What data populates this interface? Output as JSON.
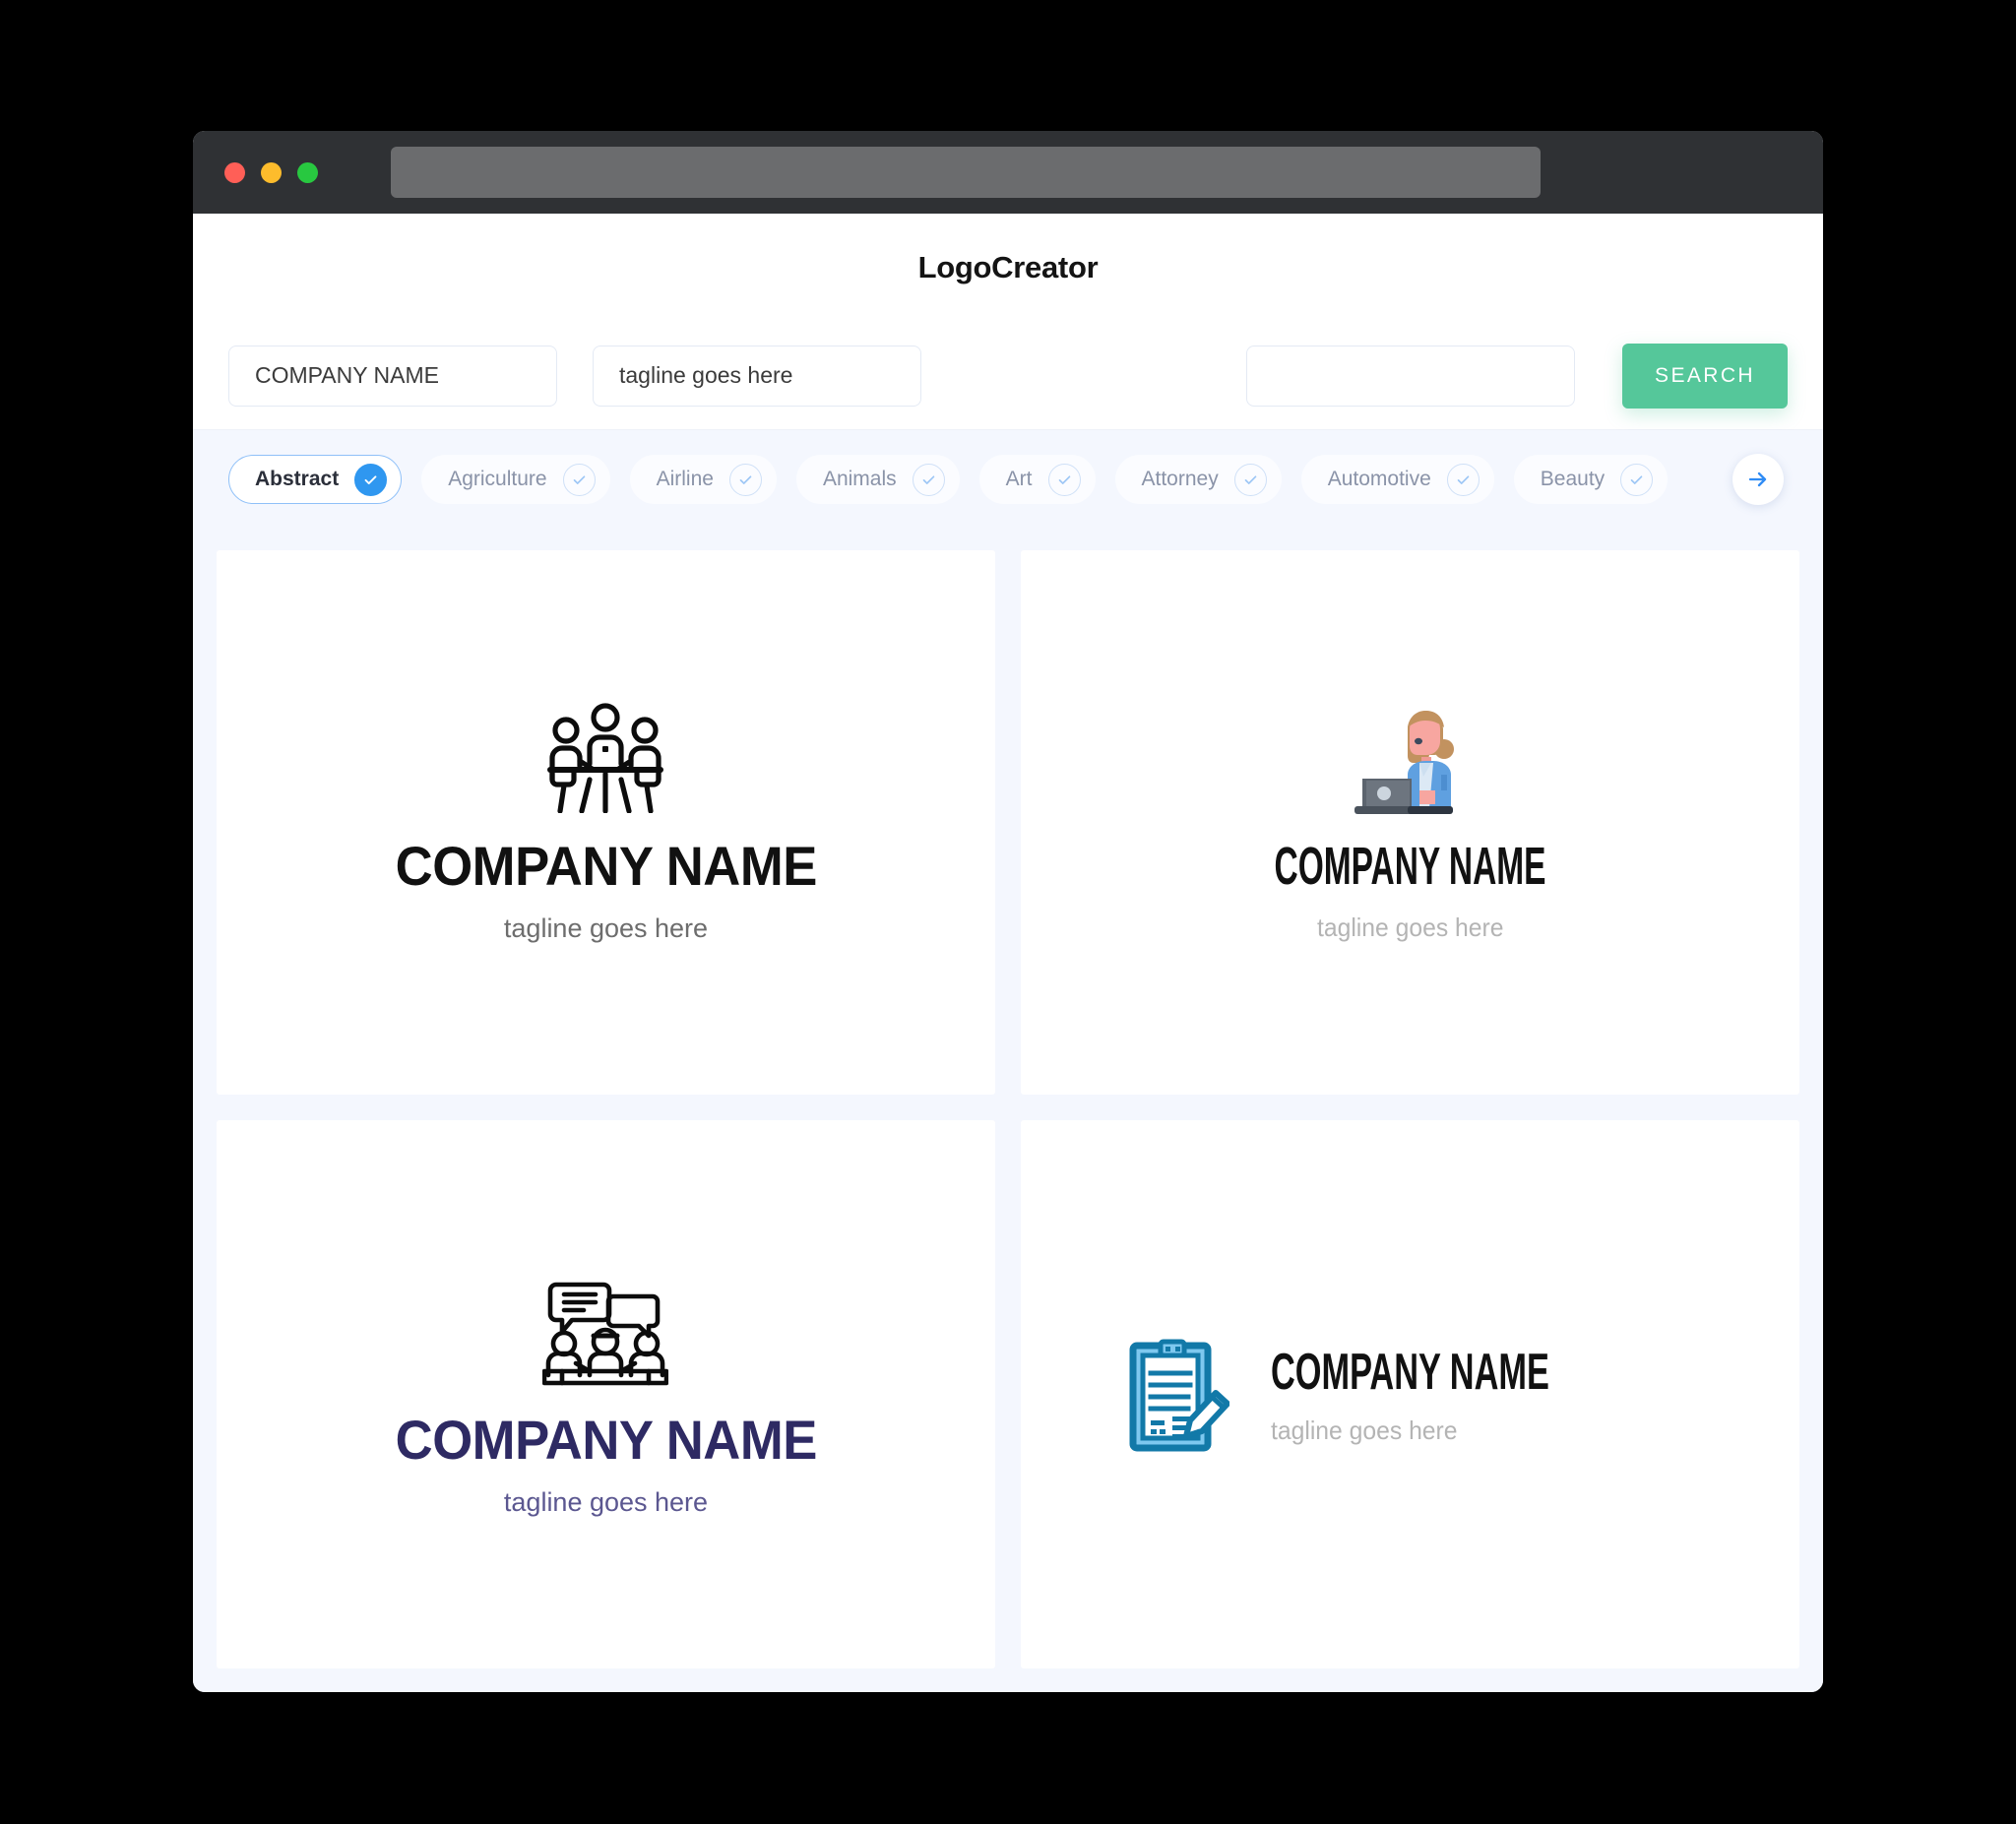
{
  "window": {
    "traffic_lights": [
      "close",
      "minimize",
      "maximize"
    ],
    "url_value": ""
  },
  "header": {
    "title": "LogoCreator"
  },
  "search": {
    "company_value": "COMPANY NAME",
    "company_placeholder": "COMPANY NAME",
    "tagline_value": "tagline goes here",
    "tagline_placeholder": "tagline goes here",
    "extra_value": "",
    "extra_placeholder": "",
    "search_label": "SEARCH",
    "search_button_color": "#55c79a"
  },
  "categories": {
    "next_icon": "arrow-right-icon",
    "accent_color": "#2f97f0",
    "items": [
      {
        "label": "Abstract",
        "selected": true
      },
      {
        "label": "Agriculture",
        "selected": false
      },
      {
        "label": "Airline",
        "selected": false
      },
      {
        "label": "Animals",
        "selected": false
      },
      {
        "label": "Art",
        "selected": false
      },
      {
        "label": "Attorney",
        "selected": false
      },
      {
        "label": "Automotive",
        "selected": false
      },
      {
        "label": "Beauty",
        "selected": false
      }
    ]
  },
  "results": [
    {
      "icon": "meeting-table-people-icon",
      "name": "COMPANY NAME",
      "tagline": "tagline goes here",
      "name_color": "#111111",
      "tagline_color": "#6d6d6d",
      "layout": "stacked"
    },
    {
      "icon": "woman-with-laptop-icon",
      "name": "COMPANY NAME",
      "tagline": "tagline goes here",
      "name_color": "#111111",
      "tagline_color": "#b4b4b4",
      "layout": "stacked"
    },
    {
      "icon": "discussion-speech-bubbles-icon",
      "name": "COMPANY NAME",
      "tagline": "tagline goes here",
      "name_color": "#2e2a63",
      "tagline_color": "#5b5790",
      "layout": "stacked"
    },
    {
      "icon": "clipboard-pencil-icon",
      "name": "COMPANY NAME",
      "tagline": "tagline goes here",
      "name_color": "#111111",
      "tagline_color": "#b4b4b4",
      "layout": "horizontal"
    }
  ]
}
